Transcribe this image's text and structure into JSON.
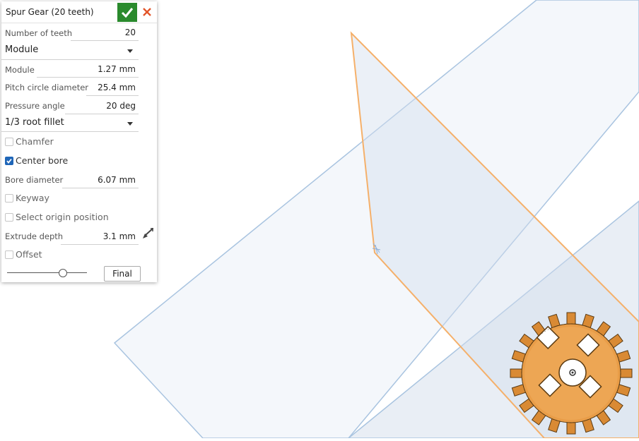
{
  "dialog": {
    "title": "Spur Gear (20 teeth)",
    "fields": {
      "number_of_teeth": {
        "label": "Number of teeth",
        "value": "20"
      },
      "size_mode": {
        "value": "Module"
      },
      "module": {
        "label": "Module",
        "value": "1.27 mm"
      },
      "pitch_circle_diameter": {
        "label": "Pitch circle diameter",
        "value": "25.4 mm"
      },
      "pressure_angle": {
        "label": "Pressure angle",
        "value": "20 deg"
      },
      "root_fillet": {
        "value": "1/3 root fillet"
      },
      "chamfer": {
        "label": "Chamfer",
        "checked": false
      },
      "center_bore": {
        "label": "Center bore",
        "checked": true
      },
      "bore_diameter": {
        "label": "Bore diameter",
        "value": "6.07 mm"
      },
      "keyway": {
        "label": "Keyway",
        "checked": false
      },
      "select_origin_position": {
        "label": "Select origin position",
        "checked": false
      },
      "extrude_depth": {
        "label": "Extrude depth",
        "value": "3.1 mm"
      },
      "offset": {
        "label": "Offset",
        "checked": false
      }
    },
    "final_button": "Final",
    "rollback_slider_position": 0.7
  },
  "icons": {
    "accept": "check-icon",
    "cancel": "close-icon",
    "direction": "extrude-direction-icon"
  },
  "colors": {
    "accept_button": "#2a8a2d",
    "cancel_icon": "#e2552a",
    "plane_edge": "#a9c4e0",
    "selected_plane_edge": "#f5b06a",
    "gear": "#e79c45"
  }
}
